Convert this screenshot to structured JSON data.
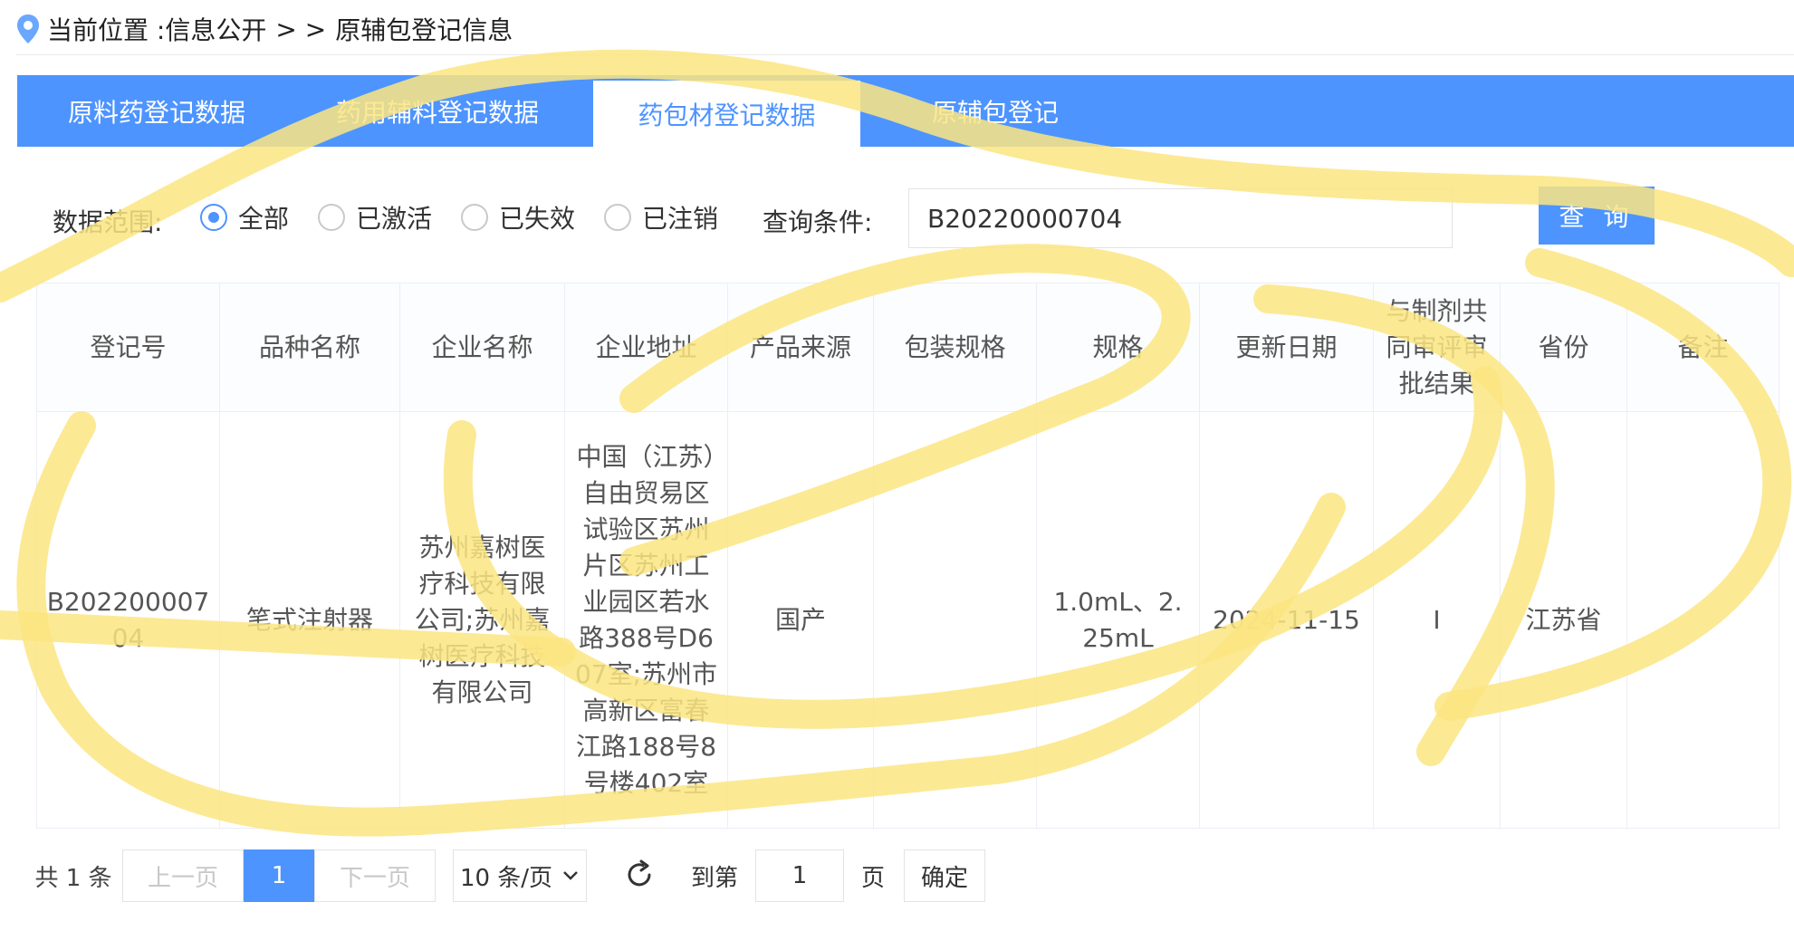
{
  "breadcrumb": {
    "prefix": "当前位置 : ",
    "section": "信息公开",
    "separator": "> >",
    "current": "原辅包登记信息"
  },
  "tabs": [
    {
      "label": "原料药登记数据",
      "active": false
    },
    {
      "label": "药用辅料登记数据",
      "active": false
    },
    {
      "label": "药包材登记数据",
      "active": true
    },
    {
      "label": "原辅包登记",
      "active": false
    }
  ],
  "filter": {
    "scope_label": "数据范围:",
    "options": [
      {
        "label": "全部",
        "checked": true
      },
      {
        "label": "已激活",
        "checked": false
      },
      {
        "label": "已失效",
        "checked": false
      },
      {
        "label": "已注销",
        "checked": false
      }
    ],
    "query_label": "查询条件:",
    "query_value": "B20220000704",
    "search_button": "查 询"
  },
  "table": {
    "columns": [
      "登记号",
      "品种名称",
      "企业名称",
      "企业地址",
      "产品来源",
      "包装规格",
      "规格",
      "更新日期",
      "与制剂共同审评审批结果",
      "省份",
      "备注"
    ],
    "rows": [
      [
        "B20220000704",
        "笔式注射器",
        "苏州嘉树医疗科技有限公司;苏州嘉树医疗科技有限公司",
        "中国（江苏）自由贸易区试验区苏州片区苏州工业园区若水路388号D607室;苏州市高新区富春江路188号8号楼402室",
        "国产",
        "",
        "1.0mL、2.25mL",
        "2024-11-15",
        "I",
        "江苏省",
        ""
      ]
    ]
  },
  "pagination": {
    "total_text": "共 1 条",
    "prev": "上一页",
    "current_page": "1",
    "next": "下一页",
    "page_size": "10 条/页",
    "goto_label": "到第",
    "goto_value": "1",
    "page_unit": "页",
    "confirm": "确定"
  },
  "colors": {
    "accent": "#4d94ff",
    "highlighter": "#fce581"
  }
}
